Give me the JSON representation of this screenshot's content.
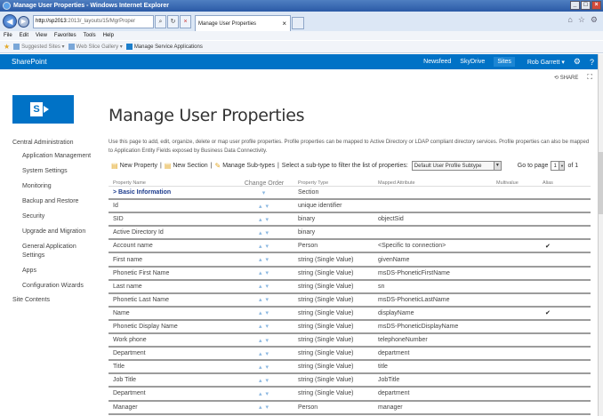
{
  "window": {
    "title": "Manage User Properties - Windows Internet Explorer"
  },
  "browser": {
    "url_domain": "http://sp2013",
    "url_rest": ":2013/_layouts/15/MgrProper",
    "tab_title": "Manage User Properties",
    "menu": [
      "File",
      "Edit",
      "View",
      "Favorites",
      "Tools",
      "Help"
    ],
    "favorites": [
      "Suggested Sites ▾",
      "Web Slice Gallery ▾",
      "Manage Service Applications"
    ]
  },
  "suite": {
    "brand": "SharePoint",
    "links": [
      "Newsfeed",
      "SkyDrive",
      "Sites"
    ],
    "user": "Rob Garrett ▾",
    "share": "SHARE"
  },
  "page": {
    "title": "Manage User Properties",
    "description": "Use this page to add, edit, organize, delete or map user profile properties. Profile properties can be mapped to Active Directory or LDAP compliant directory services. Profile properties can also be mapped to Application Entity Fields exposed by Business Data Connectivity."
  },
  "leftnav": {
    "header": "Central Administration",
    "items": [
      "Application Management",
      "System Settings",
      "Monitoring",
      "Backup and Restore",
      "Security",
      "Upgrade and Migration",
      "General Application Settings",
      "Apps",
      "Configuration Wizards"
    ],
    "site_contents": "Site Contents"
  },
  "toolbar": {
    "new_property": "New Property",
    "new_section": "New Section",
    "manage_subtypes": "Manage Sub-types",
    "filter_label": "Select a sub-type to filter the list of properties:",
    "subtype_value": "Default User Profile Subtype",
    "goto_label": "Go to page",
    "page_value": "1",
    "page_total": "of 1"
  },
  "table": {
    "headers": [
      "Property Name",
      "Change Order",
      "Property Type",
      "Mapped Attribute",
      "Multivalue",
      "Alias"
    ],
    "rows": [
      {
        "name": "> Basic Information",
        "order": "▾",
        "type": "Section",
        "mapped": "",
        "multi": "",
        "alias": ""
      },
      {
        "name": "Id",
        "order": "▴ ▾",
        "type": "unique identifier",
        "mapped": "",
        "multi": "",
        "alias": ""
      },
      {
        "name": "SID",
        "order": "▴ ▾",
        "type": "binary",
        "mapped": "objectSid",
        "multi": "",
        "alias": ""
      },
      {
        "name": "Active Directory Id",
        "order": "▴ ▾",
        "type": "binary",
        "mapped": "",
        "multi": "",
        "alias": ""
      },
      {
        "name": "Account name",
        "order": "▴ ▾",
        "type": "Person",
        "mapped": "<Specific to connection>",
        "multi": "",
        "alias": "✔"
      },
      {
        "name": "First name",
        "order": "▴ ▾",
        "type": "string (Single Value)",
        "mapped": "givenName",
        "multi": "",
        "alias": ""
      },
      {
        "name": "Phonetic First Name",
        "order": "▴ ▾",
        "type": "string (Single Value)",
        "mapped": "msDS-PhoneticFirstName",
        "multi": "",
        "alias": ""
      },
      {
        "name": "Last name",
        "order": "▴ ▾",
        "type": "string (Single Value)",
        "mapped": "sn",
        "multi": "",
        "alias": ""
      },
      {
        "name": "Phonetic Last Name",
        "order": "▴ ▾",
        "type": "string (Single Value)",
        "mapped": "msDS-PhoneticLastName",
        "multi": "",
        "alias": ""
      },
      {
        "name": "Name",
        "order": "▴ ▾",
        "type": "string (Single Value)",
        "mapped": "displayName",
        "multi": "",
        "alias": "✔"
      },
      {
        "name": "Phonetic Display Name",
        "order": "▴ ▾",
        "type": "string (Single Value)",
        "mapped": "msDS-PhoneticDisplayName",
        "multi": "",
        "alias": ""
      },
      {
        "name": "Work phone",
        "order": "▴ ▾",
        "type": "string (Single Value)",
        "mapped": "telephoneNumber",
        "multi": "",
        "alias": ""
      },
      {
        "name": "Department",
        "order": "▴ ▾",
        "type": "string (Single Value)",
        "mapped": "department",
        "multi": "",
        "alias": ""
      },
      {
        "name": "Title",
        "order": "▴ ▾",
        "type": "string (Single Value)",
        "mapped": "title",
        "multi": "",
        "alias": ""
      },
      {
        "name": "Job Title",
        "order": "▴ ▾",
        "type": "string (Single Value)",
        "mapped": "JobTitle",
        "multi": "",
        "alias": ""
      },
      {
        "name": "Department",
        "order": "▴ ▾",
        "type": "string (Single Value)",
        "mapped": "department",
        "multi": "",
        "alias": ""
      },
      {
        "name": "Manager",
        "order": "▴ ▾",
        "type": "Person",
        "mapped": "manager",
        "multi": "",
        "alias": ""
      }
    ]
  },
  "colors": {
    "suite_bar": "#0072c6",
    "section_text": "#1b3a8c",
    "order_arrows": "#8ab7e0"
  }
}
